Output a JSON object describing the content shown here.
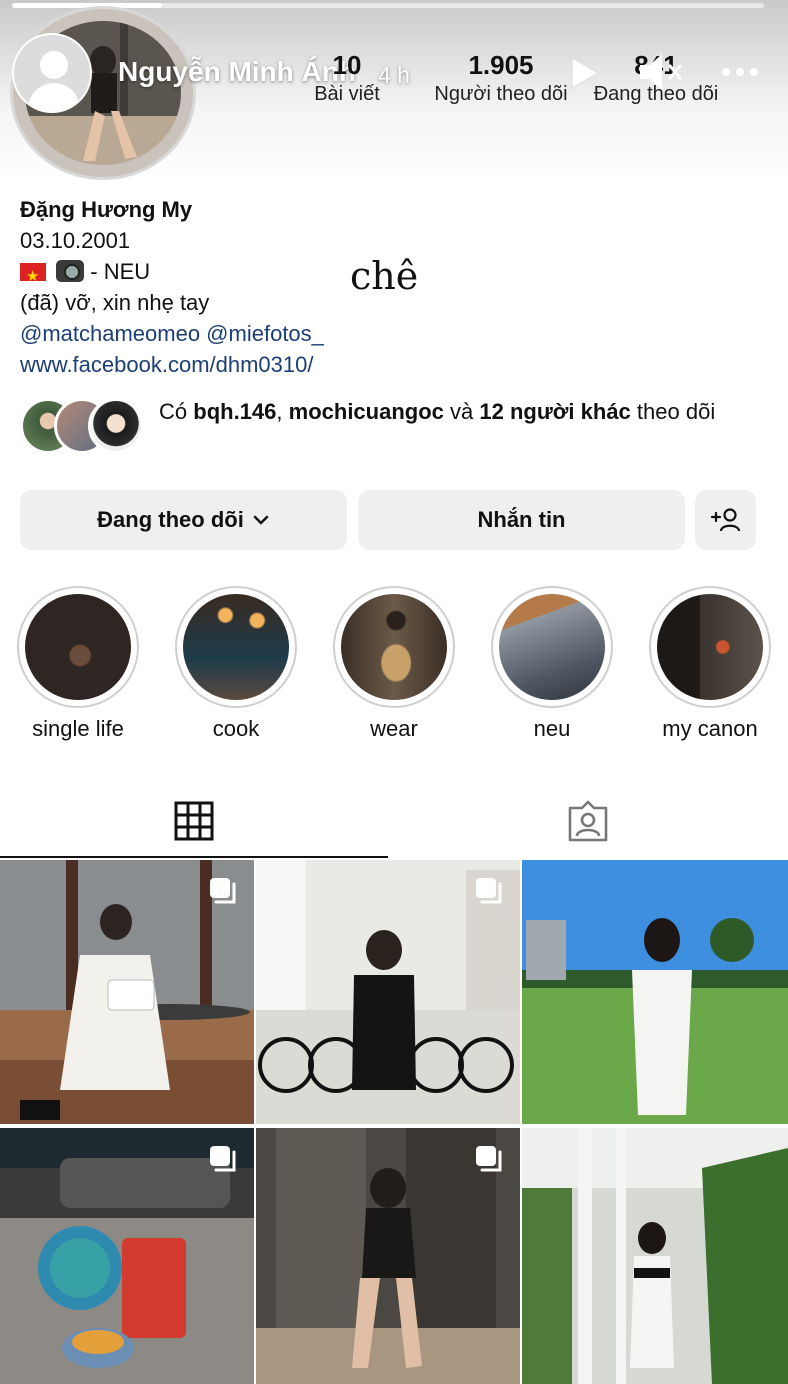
{
  "story": {
    "user": "Nguyễn Minh Ánh",
    "time": "4 h",
    "progress": 0.2
  },
  "profile": {
    "stats": [
      {
        "num": "10",
        "label": "Bài viết"
      },
      {
        "num": "1.905",
        "label": "Người theo dõi"
      },
      {
        "num": "841",
        "label": "Đang theo dõi"
      }
    ],
    "name": "Đặng Hương My",
    "birthday": "03.10.2001",
    "school": "- NEU",
    "status": "(đã) vỡ, xin nhẹ tay",
    "mentions": "@matchameomeo @miefotos_",
    "website": "www.facebook.com/dhm0310/",
    "sticker": "chê"
  },
  "mutuals": {
    "prefix": "Có",
    "user1": "bqh.146",
    "sep": ",",
    "user2": "mochicuangoc",
    "and": "và",
    "others": "12 người khác",
    "suffix": "theo dõi"
  },
  "buttons": {
    "following": "Đang theo dõi",
    "message": "Nhắn tin"
  },
  "highlights": [
    {
      "label": "single life"
    },
    {
      "label": "cook"
    },
    {
      "label": "wear"
    },
    {
      "label": "neu"
    },
    {
      "label": "my canon"
    }
  ],
  "tabs": {
    "active": "posts-grid"
  },
  "colors": {
    "link": "#1c3f73",
    "button_bg": "#efefef"
  },
  "icons": [
    "play-icon",
    "mute-icon",
    "more-icon",
    "grid-icon",
    "tagged-icon",
    "add-person-icon",
    "chevron-down-icon",
    "multi-photo-icon"
  ]
}
